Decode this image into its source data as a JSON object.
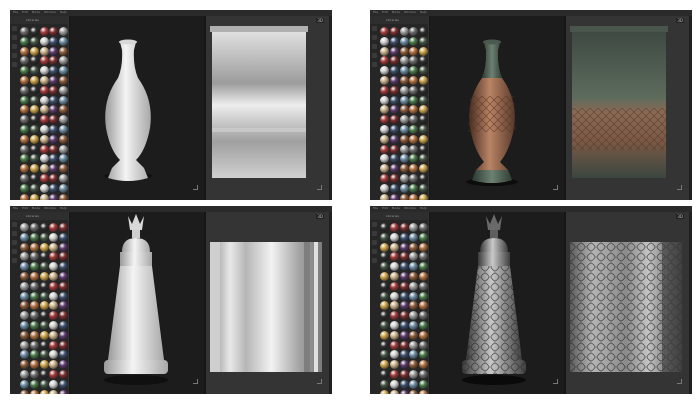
{
  "panels": [
    {
      "id": "top-before",
      "menu": [
        "File",
        "Edit",
        "Mode",
        "Window",
        "Help"
      ],
      "library_title": "Libraries",
      "viewport_label": "3D",
      "model": "vase",
      "state": "untextured"
    },
    {
      "id": "top-after",
      "menu": [
        "File",
        "Edit",
        "Mode",
        "Window",
        "Help"
      ],
      "library_title": "Libraries",
      "viewport_label": "3D",
      "model": "vase",
      "state": "textured"
    },
    {
      "id": "bottom-before",
      "menu": [
        "File",
        "Edit",
        "Mode",
        "Window",
        "Help"
      ],
      "library_title": "Libraries",
      "viewport_label": "3D",
      "model": "urn",
      "state": "untextured"
    },
    {
      "id": "bottom-after",
      "menu": [
        "File",
        "Edit",
        "Mode",
        "Window",
        "Help"
      ],
      "library_title": "Libraries",
      "viewport_label": "3D",
      "model": "urn",
      "state": "textured"
    }
  ],
  "arrows": [
    "arrow-right-icon",
    "arrow-right-icon"
  ],
  "colors": {
    "background": "#ffffff",
    "panel": "#161616",
    "arrow": "#ffffff",
    "clay": "#e6e6e6",
    "ceramic": "#9a6a4e",
    "silver": "#8a8a8a"
  }
}
